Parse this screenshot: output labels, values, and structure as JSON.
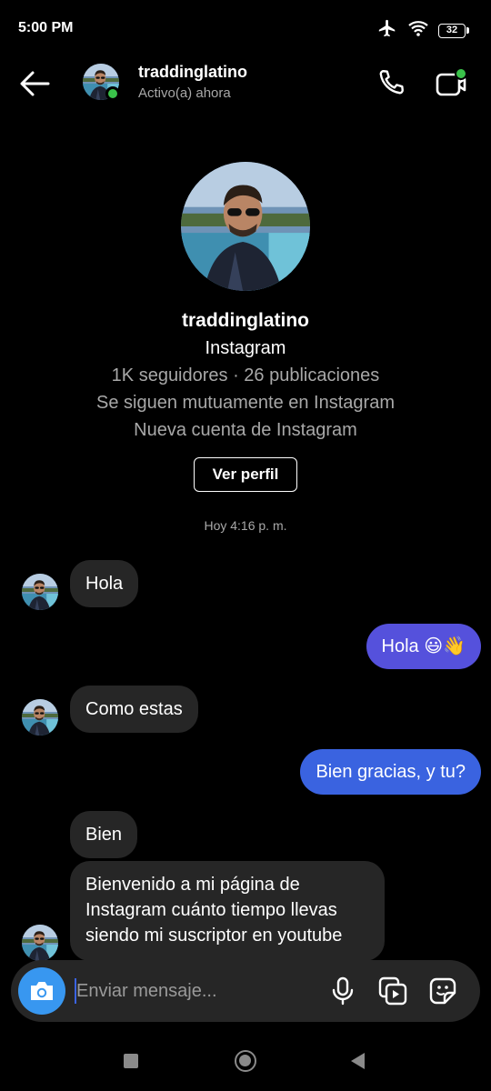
{
  "status_bar": {
    "time": "5:00 PM",
    "battery": "32"
  },
  "header": {
    "username": "traddinglatino",
    "status": "Activo(a) ahora"
  },
  "profile": {
    "name": "traddinglatino",
    "platform": "Instagram",
    "stats": "1K seguidores · 26 publicaciones",
    "mutual": "Se siguen mutuamente en Instagram",
    "new_account": "Nueva cuenta de Instagram",
    "view_profile_label": "Ver perfil"
  },
  "timestamp": "Hoy 4:16 p. m.",
  "messages": [
    {
      "from": "them",
      "text": "Hola"
    },
    {
      "from": "me",
      "text": "Hola 😃👋"
    },
    {
      "from": "them",
      "text": "Como estas"
    },
    {
      "from": "me",
      "text": "Bien gracias, y tu?"
    },
    {
      "from": "them",
      "text": "Bien"
    },
    {
      "from": "them",
      "text": "Bienvenido a mi página de Instagram cuánto tiempo llevas siendo mi suscriptor en youtube"
    }
  ],
  "composer": {
    "placeholder": "Enviar mensaje..."
  },
  "icons": [
    "airplane-icon",
    "wifi-icon",
    "battery-icon",
    "back-arrow-icon",
    "phone-icon",
    "video-icon",
    "camera-icon",
    "microphone-icon",
    "gallery-icon",
    "sticker-icon"
  ],
  "colors": {
    "accent_purple": "#5551dc",
    "accent_blue": "#3a63e0",
    "camera_blue": "#3897f0",
    "online_green": "#3ac24a"
  }
}
